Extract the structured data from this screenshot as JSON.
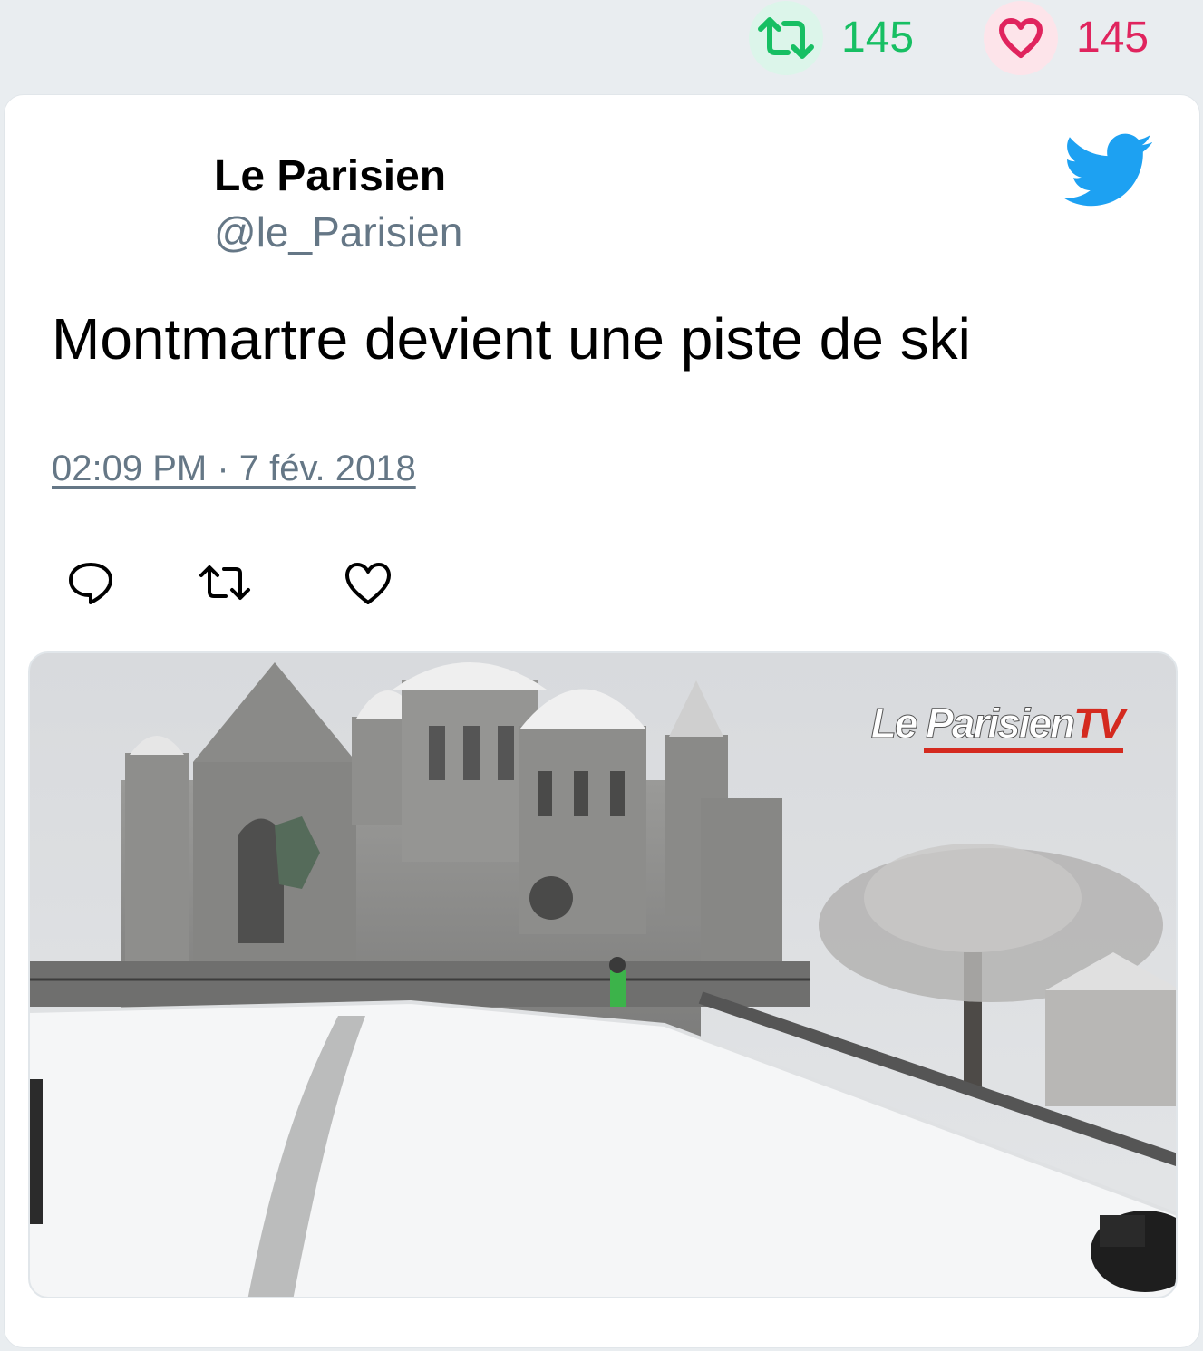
{
  "stats": {
    "retweet_icon": "retweet-icon",
    "retweet_count": "145",
    "like_icon": "heart-icon",
    "like_count": "145",
    "retweet_color": "#17bf63",
    "like_color": "#e0245e"
  },
  "tweet": {
    "author_name": "Le Parisien",
    "author_handle": "@le_Parisien",
    "text": "Montmartre devient une piste de ski",
    "timestamp": "02:09 PM · 7 fév. 2018",
    "brand_icon": "twitter-bird-icon",
    "brand_color": "#1da1f2"
  },
  "actions": {
    "reply_icon": "reply-icon",
    "retweet_icon": "retweet-icon",
    "like_icon": "heart-icon"
  },
  "media": {
    "watermark_left": "Le Parisien",
    "watermark_right": "TV"
  }
}
